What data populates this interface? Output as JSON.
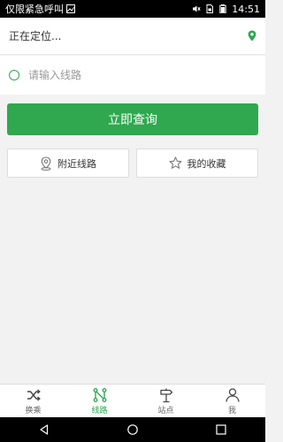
{
  "statusbar": {
    "carrier": "仅限紧急呼叫",
    "time": "14:51"
  },
  "location": {
    "text": "正在定位..."
  },
  "search": {
    "placeholder": "请输入线路"
  },
  "actions": {
    "query_label": "立即查询",
    "nearby_label": "附近线路",
    "favorites_label": "我的收藏"
  },
  "tabs": [
    {
      "label": "换乘",
      "icon": "shuffle-icon"
    },
    {
      "label": "线路",
      "icon": "route-icon",
      "active": true
    },
    {
      "label": "站点",
      "icon": "signpost-icon"
    },
    {
      "label": "我",
      "icon": "person-icon"
    }
  ],
  "colors": {
    "accent": "#2fa84f"
  }
}
